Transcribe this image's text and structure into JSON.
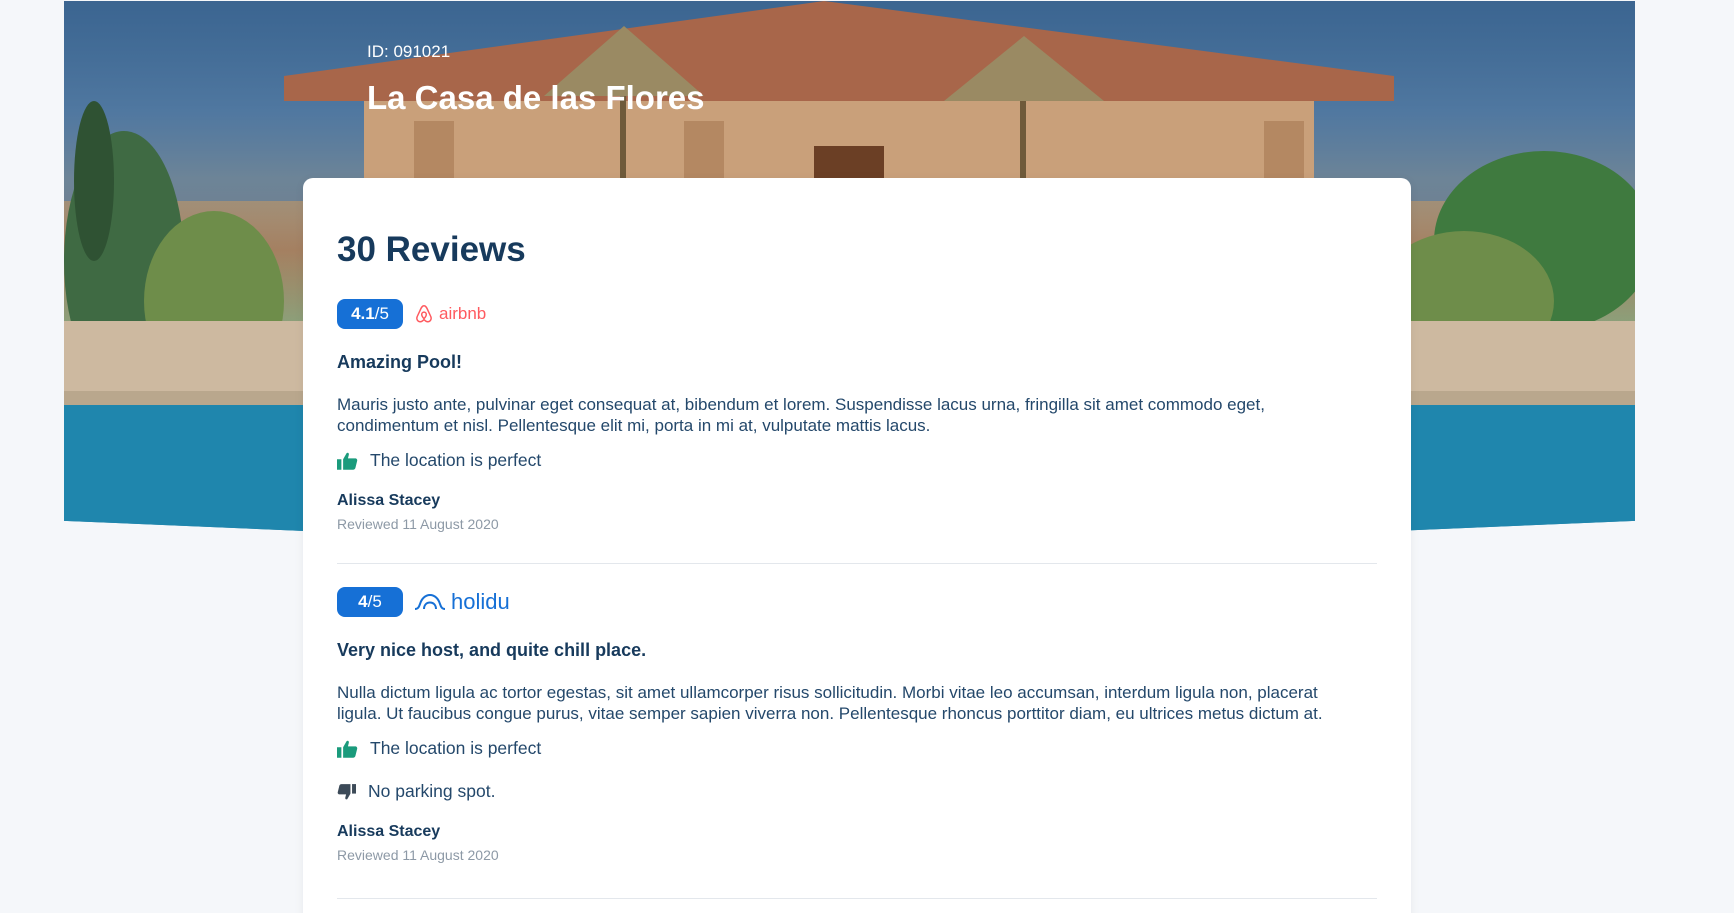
{
  "listing": {
    "id_label": "ID: 091021",
    "title": "La Casa de las Flores"
  },
  "reviews_section": {
    "heading": "30 Reviews"
  },
  "reviews": [
    {
      "score": "4.1",
      "scale": "/5",
      "source": "airbnb",
      "title": "Amazing Pool!",
      "body": "Mauris justo ante, pulvinar eget consequat at, bibendum et lorem. Suspendisse lacus urna, fringilla sit amet commodo eget, condimentum et nisl. Pellentesque elit mi, porta in mi at, vulputate mattis lacus.",
      "pros": [
        "The location is perfect"
      ],
      "cons": [],
      "reviewer": "Alissa Stacey",
      "date": "Reviewed 11 August 2020"
    },
    {
      "score": "4",
      "scale": "/5",
      "source": "holidu",
      "title": "Very nice host, and quite chill place.",
      "body": "Nulla dictum ligula ac tortor egestas, sit amet ullamcorper risus sollicitudin. Morbi vitae leo accumsan, interdum ligula non, placerat ligula. Ut faucibus congue purus, vitae semper sapien viverra non. Pellentesque rhoncus porttitor diam, eu ultrices metus dictum at.",
      "pros": [
        "The location is perfect"
      ],
      "cons": [
        "No parking spot."
      ],
      "reviewer": "Alissa Stacey",
      "date": "Reviewed 11 August 2020"
    }
  ],
  "colors": {
    "accent": "#1670d6",
    "airbnb": "#ff5a5f",
    "positive": "#1a9b7c",
    "negative": "#3c4a58",
    "heading": "#173a5c"
  },
  "icons": {
    "thumbs_up": "thumbs-up-icon",
    "thumbs_down": "thumbs-down-icon"
  }
}
